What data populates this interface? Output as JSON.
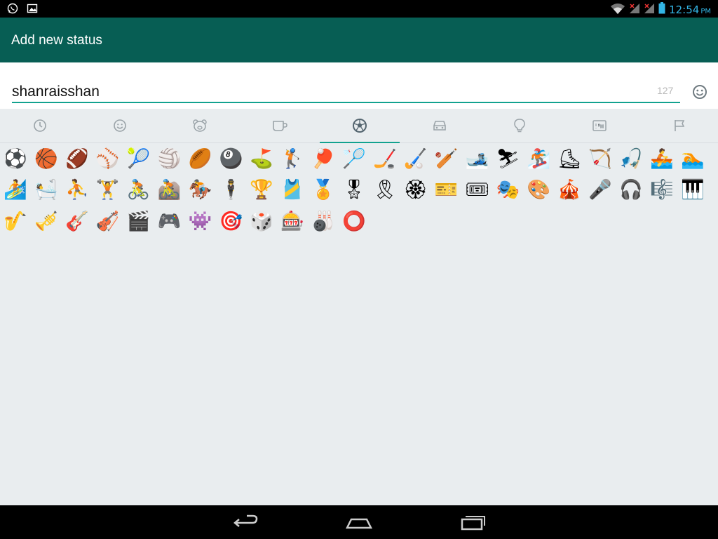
{
  "statusbar": {
    "time": "12:54",
    "ampm": "PM",
    "left_icons": [
      "whatsapp-icon",
      "image-icon"
    ],
    "right_icons": [
      "wifi-icon",
      "signal-icon",
      "signal-icon",
      "battery-icon"
    ]
  },
  "appbar": {
    "title": "Add new status"
  },
  "input": {
    "value": "shanraisshan",
    "remaining": "127"
  },
  "tabs": [
    {
      "icon": "recent-icon"
    },
    {
      "icon": "smiley-icon"
    },
    {
      "icon": "animal-icon"
    },
    {
      "icon": "food-icon"
    },
    {
      "icon": "activity-icon",
      "active": true
    },
    {
      "icon": "travel-icon"
    },
    {
      "icon": "objects-icon"
    },
    {
      "icon": "symbols-icon"
    },
    {
      "icon": "flag-icon"
    }
  ],
  "emoji_rows": [
    [
      "⚽",
      "🏀",
      "🏈",
      "⚾",
      "🎾",
      "🏐",
      "🏉",
      "🎱",
      "⛳",
      "🏌",
      "🏓",
      "🏸",
      "🏒",
      "🏑",
      "🏏",
      "🎿",
      "⛷",
      "🏂",
      "⛸",
      "🏹",
      "🎣",
      "🚣",
      "🏊"
    ],
    [
      "🏄",
      "🛀",
      "⛹",
      "🏋",
      "🚴",
      "🚵",
      "🏇",
      "🕴",
      "🏆",
      "🎽",
      "🏅",
      "🎖",
      "🎗",
      "🏵",
      "🎫",
      "🎟",
      "🎭",
      "🎨",
      "🎪",
      "🎤",
      "🎧",
      "🎼",
      "🎹"
    ],
    [
      "🎷",
      "🎺",
      "🎸",
      "🎻",
      "🎬",
      "🎮",
      "👾",
      "🎯",
      "🎲",
      "🎰",
      "🎳",
      "⭕"
    ]
  ],
  "colors": {
    "appbar": "#075e54",
    "accent": "#12a28f",
    "statusbar_time": "#33b5e5"
  }
}
